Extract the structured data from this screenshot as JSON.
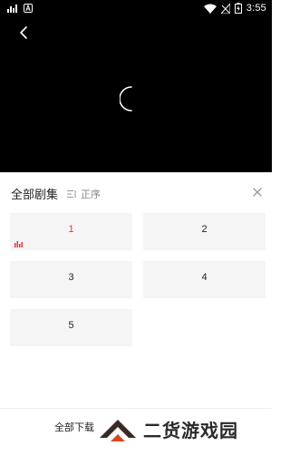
{
  "status_bar": {
    "time": "3:55",
    "icons": [
      "signal-activity-icon",
      "app-a-icon",
      "wifi-icon",
      "no-signal-icon",
      "battery-charging-icon"
    ]
  },
  "player": {
    "back_icon": "chevron-left-icon",
    "loading_icon": "spinner-icon"
  },
  "episodes_panel": {
    "title": "全部剧集",
    "sort_label": "正序",
    "sort_icon": "sort-list-icon",
    "close_icon": "close-icon",
    "episodes": [
      {
        "label": "1",
        "active": true
      },
      {
        "label": "2",
        "active": false
      },
      {
        "label": "3",
        "active": false
      },
      {
        "label": "4",
        "active": false
      },
      {
        "label": "5",
        "active": false
      }
    ],
    "active_color": "#e8343f"
  },
  "footer": {
    "download_all": "全部下载"
  },
  "watermark": {
    "text": "二货游戏园"
  }
}
